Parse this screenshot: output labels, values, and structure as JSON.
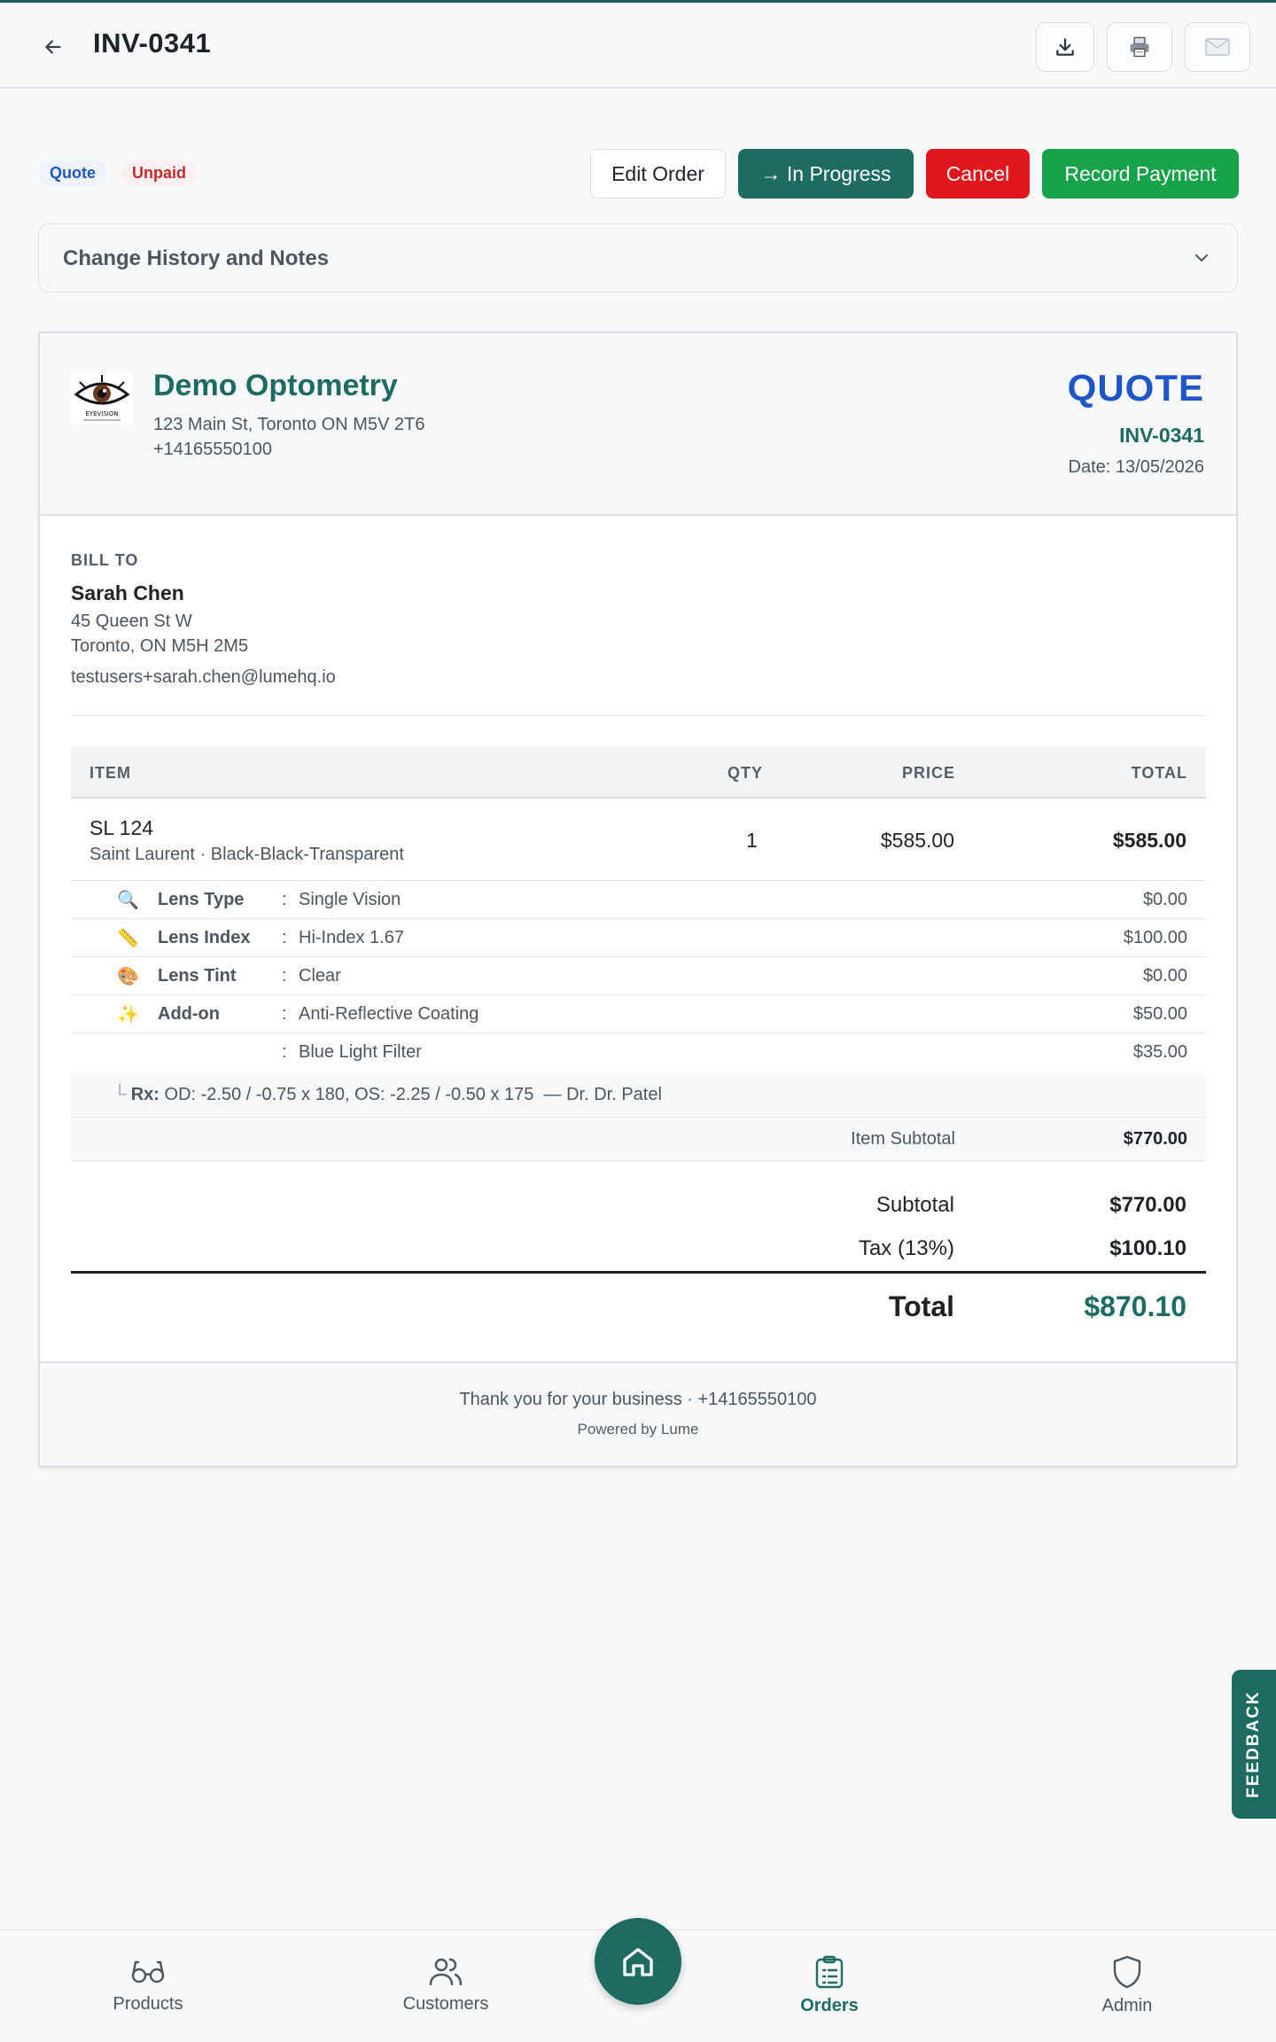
{
  "header": {
    "title": "INV-0341",
    "actions": [
      "download-icon",
      "printer-icon",
      "mail-icon"
    ]
  },
  "status": {
    "badges": [
      "Quote",
      "Unpaid"
    ],
    "edit_label": "Edit Order",
    "progress_label": "→ In Progress",
    "cancel_label": "Cancel",
    "record_label": "Record Payment"
  },
  "history": {
    "label": "Change History and Notes"
  },
  "invoice": {
    "business": {
      "name": "Demo Optometry",
      "address": "123 Main St, Toronto ON M5V 2T6",
      "phone": "+14165550100",
      "logo_text": "EYEVISION"
    },
    "doc_type": "QUOTE",
    "number": "INV-0341",
    "date": "Date: 13/05/2026",
    "bill_to": {
      "label": "BILL TO",
      "name": "Sarah Chen",
      "address1": "45 Queen St W",
      "address2": "Toronto, ON M5H 2M5",
      "email": "testusers+sarah.chen@lumehq.io"
    },
    "columns": {
      "item": "ITEM",
      "qty": "QTY",
      "price": "PRICE",
      "total": "TOTAL"
    },
    "item": {
      "name": "SL 124",
      "subtitle": "Saint Laurent · Black-Black-Transparent",
      "qty": "1",
      "price": "$585.00",
      "total": "$585.00"
    },
    "options": [
      {
        "icon": "🔍",
        "label": "Lens Type",
        "colon": ":",
        "value": "Single Vision",
        "price": "$0.00"
      },
      {
        "icon": "📏",
        "label": "Lens Index",
        "colon": ":",
        "value": "Hi-Index 1.67",
        "price": "$100.00"
      },
      {
        "icon": "🎨",
        "label": "Lens Tint",
        "colon": ":",
        "value": "Clear",
        "price": "$0.00"
      },
      {
        "icon": "✨",
        "label": "Add-on",
        "colon": ":",
        "value": "Anti-Reflective Coating",
        "price": "$50.00"
      },
      {
        "icon": "",
        "label": "",
        "colon": ":",
        "value": "Blue Light Filter",
        "price": "$35.00"
      }
    ],
    "rx": {
      "prefix": "└",
      "label": "Rx:",
      "text": "OD: -2.50 / -0.75 x 180, OS: -2.25 / -0.50 x 175",
      "doctor": "— Dr. Dr. Patel"
    },
    "item_subtotal": {
      "label": "Item Subtotal",
      "value": "$770.00"
    },
    "subtotal": {
      "label": "Subtotal",
      "value": "$770.00"
    },
    "tax": {
      "label": "Tax (13%)",
      "value": "$100.10"
    },
    "total": {
      "label": "Total",
      "value": "$870.10"
    },
    "footer": {
      "thanks": "Thank you for your business · +14165550100",
      "powered": "Powered by Lume"
    }
  },
  "feedback": {
    "label": "FEEDBACK"
  },
  "nav": {
    "items": [
      {
        "label": "Products",
        "icon": "glasses-icon"
      },
      {
        "label": "Customers",
        "icon": "users-icon"
      },
      {
        "label": "Orders",
        "icon": "clipboard-icon"
      },
      {
        "label": "Admin",
        "icon": "shield-icon"
      }
    ],
    "home_icon": "home-icon"
  },
  "colors": {
    "brand": "#1d6b61",
    "quote_blue": "#1e55c9",
    "cancel_red": "#e0181d",
    "record_green": "#18a24a"
  }
}
